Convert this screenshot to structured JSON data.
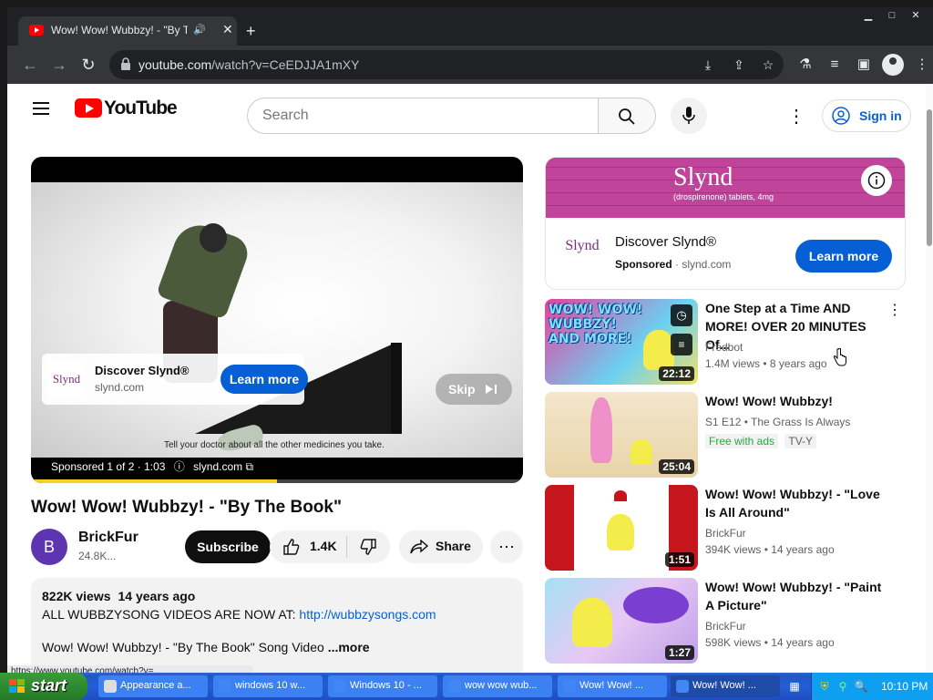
{
  "browser": {
    "tab_title": "Wow! Wow! Wubbzy! - \"By The Book\"",
    "url_host": "youtube.com",
    "url_path": "/watch?v=CeEDJJA1mXY"
  },
  "header": {
    "logo_text": "YouTube",
    "search_placeholder": "Search",
    "sign_in_label": "Sign in"
  },
  "player": {
    "ad_name": "Discover Slynd®",
    "ad_domain": "slynd.com",
    "ad_learn_more": "Learn more",
    "skip_label": "Skip",
    "video_caption": "Tell your doctor about all the other medicines you take.",
    "sponsored_text": "Sponsored 1 of 2 · 1:03",
    "sponsored_domain": "slynd.com",
    "ad_progress": 0.5
  },
  "video": {
    "title": "Wow! Wow! Wubbzy! - \"By The Book\"",
    "channel_initial": "B",
    "channel_name": "BrickFur",
    "subscribers": "24.8K...",
    "subscribe_label": "Subscribe",
    "like_count": "1.4K",
    "share_label": "Share",
    "views": "822K views",
    "age": "14 years ago",
    "desc_prefix": "ALL WUBBZYSONG VIDEOS ARE NOW AT: ",
    "desc_link": "http://wubbzysongs.com",
    "desc_line2": "Wow! Wow! Wubbzy! - \"By The Book\" Song Video ",
    "desc_more": "...more"
  },
  "sidebar_ad": {
    "brand": "Slynd",
    "brand_sub": "(drospirenone) tablets, 4mg",
    "logo": "Slynd",
    "title": "Discover Slynd®",
    "sponsored": "Sponsored",
    "domain": "slynd.com",
    "learn_more": "Learn more"
  },
  "recommendations": [
    {
      "title": "One Step at a Time AND MORE! OVER 20 MINUTES Of...",
      "channel": "Fredbot",
      "meta": "1.4M views  •  8 years ago",
      "duration": "22:12",
      "thumb_text": "WOW! WOW! WUBBZY! AND MORE!"
    },
    {
      "title": "Wow! Wow! Wubbzy!",
      "channel": "S1 E12 • The Grass Is Always",
      "meta": "",
      "duration": "25:04",
      "badge1": "Free with ads",
      "badge2": "TV-Y"
    },
    {
      "title": "Wow! Wow! Wubbzy! - \"Love Is All Around\"",
      "channel": "BrickFur",
      "meta": "394K views  •  14 years ago",
      "duration": "1:51"
    },
    {
      "title": "Wow! Wow! Wubbzy! - \"Paint A Picture\"",
      "channel": "BrickFur",
      "meta": "598K views  •  14 years ago",
      "duration": "1:27"
    }
  ],
  "status_url": "https://www.youtube.com/watch?v=...",
  "taskbar": {
    "start_label": "start",
    "tasks": [
      "Appearance a...",
      "windows 10 w...",
      "Windows 10 - ...",
      "wow wow wub...",
      "Wow! Wow! ...",
      "Wow! Wow! ..."
    ],
    "clock": "10:10 PM"
  }
}
